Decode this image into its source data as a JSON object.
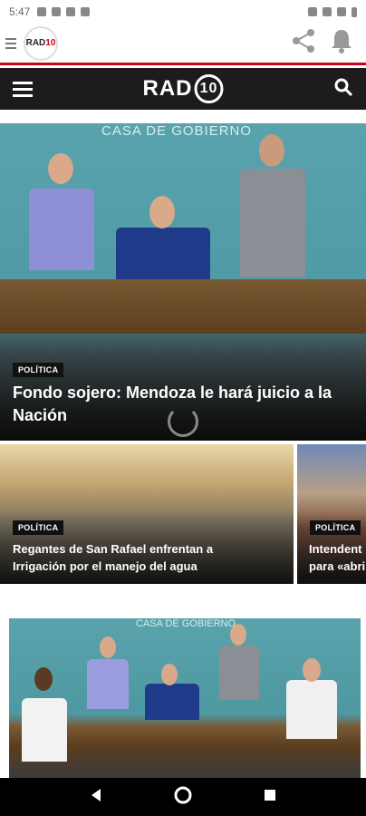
{
  "status_bar": {
    "time": "5:47"
  },
  "app_bar": {
    "logo_text": "RAD",
    "logo_number": "10"
  },
  "nav_bar": {
    "brand_text": "RAD",
    "brand_number": "10"
  },
  "hero": {
    "backdrop_text": "CASA DE GOBIERNO",
    "category": "POLÍTICA",
    "title": "Fondo sojero: Mendoza le hará juicio a la Nación"
  },
  "cards": [
    {
      "category": "POLÍTICA",
      "title": "Regantes de San Rafael enfrentan a Irrigación por el manejo del agua"
    },
    {
      "category": "POLÍTICA",
      "title": "Intendent para «abri"
    }
  ],
  "second_article": {
    "backdrop_text": "CASA DE GOBIERNO"
  },
  "colors": {
    "accent": "#d0021b",
    "nav_bg": "#1c1c1c"
  }
}
